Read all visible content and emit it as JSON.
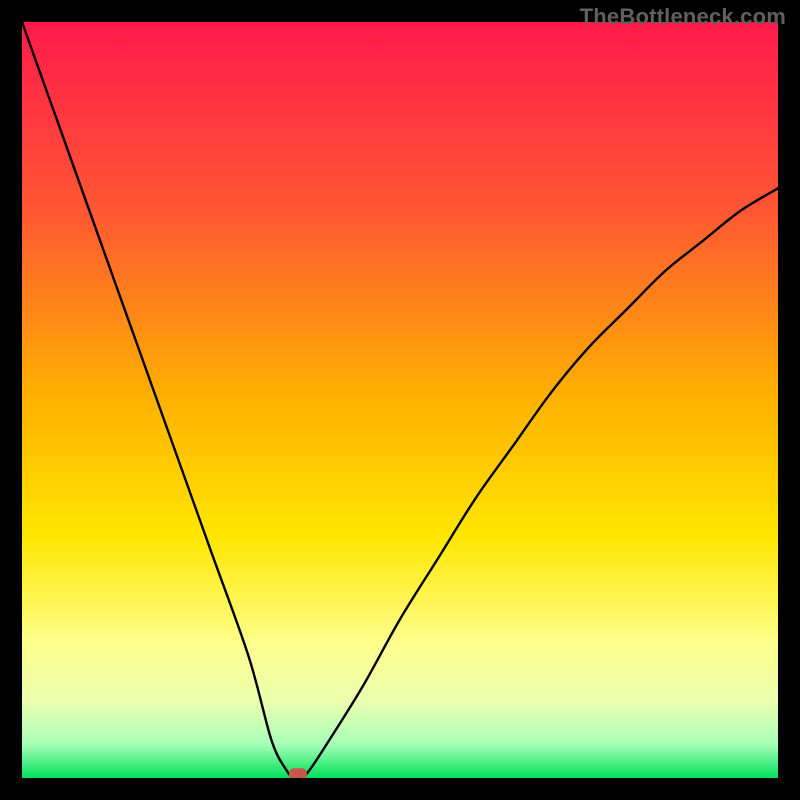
{
  "watermark": "TheBottleneck.com",
  "chart_data": {
    "type": "line",
    "title": "",
    "xlabel": "",
    "ylabel": "",
    "xlim": [
      0,
      100
    ],
    "ylim": [
      0,
      100
    ],
    "grid": false,
    "series": [
      {
        "name": "bottleneck-curve",
        "x": [
          0,
          5,
          10,
          15,
          20,
          25,
          30,
          33,
          35,
          36,
          37,
          38,
          40,
          45,
          50,
          55,
          60,
          65,
          70,
          75,
          80,
          85,
          90,
          95,
          100
        ],
        "y": [
          100,
          86,
          72,
          58,
          44,
          30,
          16,
          5,
          1,
          0,
          0,
          1,
          4,
          12,
          21,
          29,
          37,
          44,
          51,
          57,
          62,
          67,
          71,
          75,
          78
        ]
      }
    ],
    "marker": {
      "x": 36.5,
      "y": 0.5
    },
    "background": {
      "type": "vertical-gradient",
      "stops": [
        {
          "pos": 0.0,
          "color": "#ff1a4b"
        },
        {
          "pos": 0.25,
          "color": "#ff5733"
        },
        {
          "pos": 0.5,
          "color": "#ffb200"
        },
        {
          "pos": 0.68,
          "color": "#ffe600"
        },
        {
          "pos": 0.82,
          "color": "#fdff8a"
        },
        {
          "pos": 0.9,
          "color": "#eaffb0"
        },
        {
          "pos": 0.955,
          "color": "#a8ffb8"
        },
        {
          "pos": 1.0,
          "color": "#00e05a"
        }
      ]
    }
  }
}
